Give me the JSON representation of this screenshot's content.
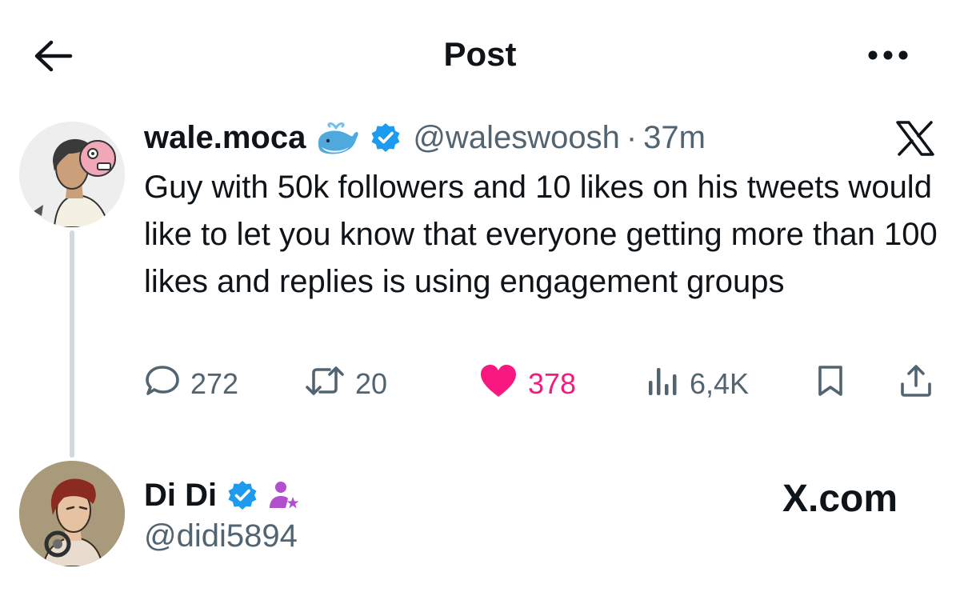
{
  "header": {
    "title": "Post",
    "back_icon": "arrow-left-icon",
    "more_icon": "more-horizontal-icon"
  },
  "tweet": {
    "author_name": "wale.moca",
    "handle": "@waleswoosh",
    "separator": "·",
    "time": "37m",
    "text": "Guy with 50k followers and 10 likes on his tweets would like to let you know that everyone getting more than 100 likes and replies is using engagement groups",
    "stats": {
      "replies": "272",
      "reposts": "20",
      "likes": "378",
      "views": "6,4K"
    }
  },
  "watermark": {
    "author_name": "Di Di",
    "handle": "@didi5894",
    "site": "X.com"
  },
  "colors": {
    "text": "#0f1419",
    "secondary": "#536471",
    "verified": "#1d9bf0",
    "like": "#f91880",
    "thread_line": "#cfd9de",
    "affiliate": "#b24fcf"
  }
}
